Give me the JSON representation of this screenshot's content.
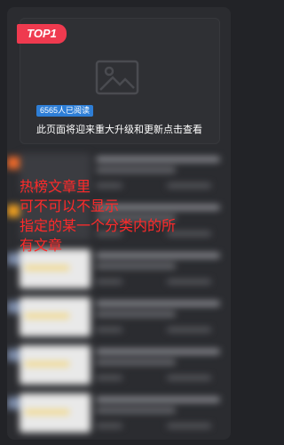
{
  "top_article": {
    "badge": "TOP1",
    "read_count": "6565人已阅读",
    "title": "此页面将迎来重大升级和更新点击查看"
  },
  "annotation": {
    "lines": [
      "热榜文章里",
      "可不可以不显示",
      "指定的某一个分类内的所",
      "有文章"
    ]
  },
  "colors": {
    "accent_red": "#ef3a4f",
    "read_count_blue": "#2e7ed6",
    "annotation_red": "#ff2a2a"
  },
  "icons": {
    "placeholder": "image-placeholder-icon"
  }
}
